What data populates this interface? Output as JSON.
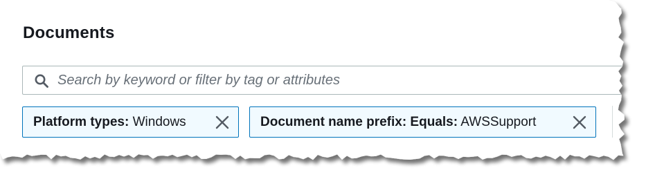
{
  "page": {
    "title": "Documents"
  },
  "search": {
    "placeholder": "Search by keyword or filter by tag or attributes",
    "icon": "search-icon"
  },
  "filters": [
    {
      "key": "Platform types:",
      "value": "Windows",
      "remove_icon": "close-icon"
    },
    {
      "key": "Document name prefix: Equals:",
      "value": "AWSSupport",
      "remove_icon": "close-icon"
    }
  ],
  "colors": {
    "token_border": "#0073bb",
    "token_background": "#f1faff",
    "text": "#16191f",
    "placeholder": "#687078",
    "input_border": "#aab7b8"
  }
}
